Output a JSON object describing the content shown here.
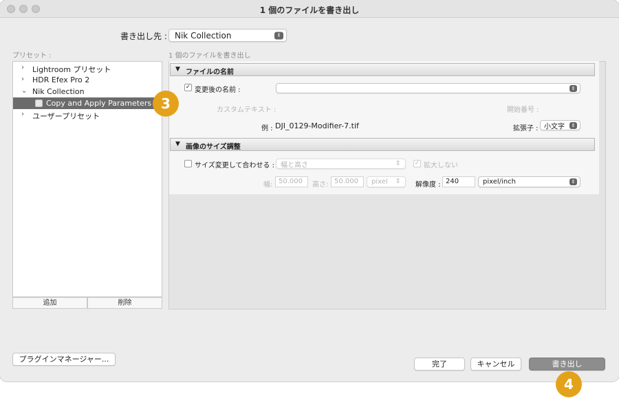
{
  "window": {
    "title": "1 個のファイルを書き出し"
  },
  "destination": {
    "label": "書き出し先 :",
    "value": "Nik Collection"
  },
  "presets": {
    "header": "プリセット :",
    "items": [
      {
        "label": "Lightroom プリセット",
        "chevron": "›"
      },
      {
        "label": "HDR Efex Pro 2",
        "chevron": "›"
      },
      {
        "label": "Nik Collection",
        "chevron": "⌄"
      },
      {
        "label": "Copy and Apply Parameters",
        "chevron": ""
      },
      {
        "label": "ユーザープリセット",
        "chevron": "›"
      }
    ],
    "add_label": "追加",
    "delete_label": "削除"
  },
  "main": {
    "subtitle": "1 個のファイルを書き出し",
    "file_name_section": {
      "title": "ファイルの名前",
      "rename_label": "変更後の名前 :",
      "rename_checked": true,
      "custom_text_label": "カスタムテキスト :",
      "start_number_label": "開始番号 :",
      "example_label": "例 :",
      "example_value": "DJI_0129-Modifier-7.tif",
      "extension_label": "拡張子 :",
      "extension_value": "小文字"
    },
    "resize_section": {
      "title": "画像のサイズ調整",
      "fit_label": "サイズ変更して合わせる :",
      "fit_checked": false,
      "fit_value": "幅と高さ",
      "no_enlarge_label": "拡大しない",
      "no_enlarge_checked": true,
      "width_label": "幅:",
      "width_value": "50.000",
      "height_label": "高さ:",
      "height_value": "50.000",
      "unit_value": "pixel",
      "resolution_label": "解像度 :",
      "resolution_value": "240",
      "resolution_unit": "pixel/inch"
    }
  },
  "footer": {
    "plugin_manager_label": "プラグインマネージャー...",
    "done_label": "完了",
    "cancel_label": "キャンセル",
    "export_label": "書き出し"
  },
  "badges": {
    "presets_step": "3",
    "export_step": "4"
  },
  "colors": {
    "badge": "#e4a21a",
    "selected_row": "#6b6b6b"
  }
}
